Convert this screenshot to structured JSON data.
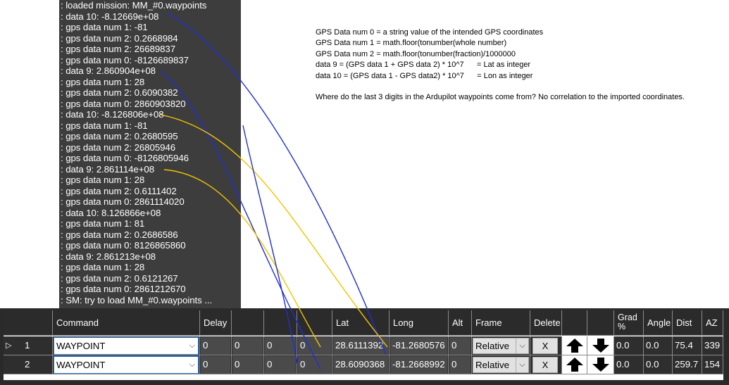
{
  "console": {
    "lines": [
      ": loaded mission: MM_#0.waypoints",
      ": data 10: -8.12669e+08",
      ": gps data num 1: -81",
      ": gps data num 2: 0.2668984",
      ": gps data num 2: 26689837",
      ": gps data num 0: -8126689837",
      ": data 9: 2.860904e+08",
      ": gps data num 1: 28",
      ": gps data num 2: 0.6090382",
      ": gps data num 0: 2860903820",
      ": data 10: -8.126806e+08",
      ": gps data num 1: -81",
      ": gps data num 2: 0.2680595",
      ": gps data num 2: 26805946",
      ": gps data num 0: -8126805946",
      ": data 9: 2.861114e+08",
      ": gps data num 1: 28",
      ": gps data num 2: 0.6111402",
      ": gps data num 0: 2861114020",
      ": data 10: 8.126866e+08",
      ": gps data num 1: 81",
      ": gps data num 2: 0.2686586",
      ": gps data num 0: 8126865860",
      ": data 9: 2.861213e+08",
      ": gps data num 1: 28",
      ": gps data num 2: 0.6121267",
      ": gps data num 0: 2861212670",
      ": SM: try to load MM_#0.waypoints ..."
    ]
  },
  "notes": [
    "GPS Data num 0 = a string value of the intended GPS coordinates",
    "GPS Data num 1 = math.floor(tonumber(whole number)",
    "GPS Data num 2 = math.floor(tonumber(fraction)/1000000",
    "data 9 = (GPS data 1 + GPS data 2) * 10^7      = Lat as integer",
    "data 10 = (GPS data 1 - GPS data2) * 10^7      = Lon as integer",
    "",
    "Where do the last 3 digits in the Ardupilot waypoints come from? No correlation to the imported coordinates."
  ],
  "grid": {
    "headers": {
      "command": "Command",
      "delay": "Delay",
      "p2": "",
      "p3": "",
      "p4": "",
      "lat": "Lat",
      "long": "Long",
      "alt": "Alt",
      "frame": "Frame",
      "delete": "Delete",
      "up": "",
      "down": "",
      "grad": "Grad %",
      "angle": "Angle",
      "dist": "Dist",
      "az": "AZ"
    },
    "rows": [
      {
        "num": "1",
        "selected": true,
        "command": "WAYPOINT",
        "delay": "0",
        "p2": "0",
        "p3": "0",
        "p4": "0",
        "lat": "28.6111392",
        "long": "-81.2680576",
        "alt": "0",
        "frame": "Relative",
        "delete": "X",
        "grad": "0.0",
        "angle": "0.0",
        "dist": "75.4",
        "az": "339"
      },
      {
        "num": "2",
        "selected": false,
        "command": "WAYPOINT",
        "delay": "0",
        "p2": "0",
        "p3": "0",
        "p4": "0",
        "lat": "28.6090368",
        "long": "-81.2668992",
        "alt": "0",
        "frame": "Relative",
        "delete": "X",
        "grad": "0.0",
        "angle": "0.0",
        "dist": "259.7",
        "az": "154"
      }
    ]
  },
  "icons": {
    "up": "arrow-up-icon",
    "down": "arrow-down-icon",
    "dropdown": "chevron-down-icon",
    "row_selected": "row-selector-icon"
  },
  "colors": {
    "blue_line": "#1f2fd6",
    "yellow_line": "#f2c400"
  }
}
